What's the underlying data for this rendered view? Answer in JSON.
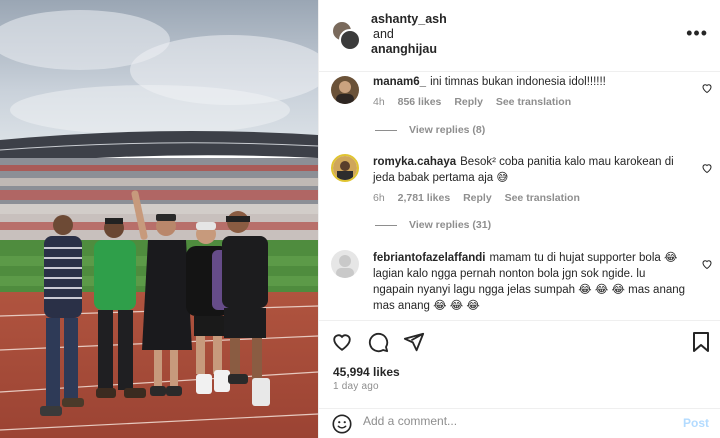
{
  "post": {
    "authors": [
      "ashanty_ash",
      "ananghijau"
    ],
    "and_text": "and",
    "more_icon": "more-horizontal-icon"
  },
  "comments": [
    {
      "username": "manam6_",
      "text": "ini timnas bukan indonesia idol!!!!!!",
      "time": "4h",
      "likes": "856 likes",
      "reply": "Reply",
      "translate": "See translation",
      "view_replies": "View replies (8)"
    },
    {
      "username": "romyka.cahaya",
      "text": "Besok² coba panitia kalo mau karokean di jeda babak pertama aja 😅",
      "time": "6h",
      "likes": "2,781 likes",
      "reply": "Reply",
      "translate": "See translation",
      "view_replies": "View replies (31)"
    },
    {
      "username": "febriantofazelaffandi",
      "text": "mamam tu di hujat supporter bola 😂 lagian kalo ngga pernah nonton bola jgn sok ngide. lu ngapain nyanyi lagu ngga jelas sumpah 😂 😂 😂  mas anang mas anang 😂 😂 😂"
    }
  ],
  "actions": {
    "likes": "45,994 likes",
    "time_ago": "1 day ago",
    "icons": [
      "heart-icon",
      "comment-icon",
      "share-icon",
      "bookmark-icon"
    ]
  },
  "add_comment": {
    "placeholder": "Add a comment...",
    "post_label": "Post",
    "post_color": "#b3dbff"
  }
}
